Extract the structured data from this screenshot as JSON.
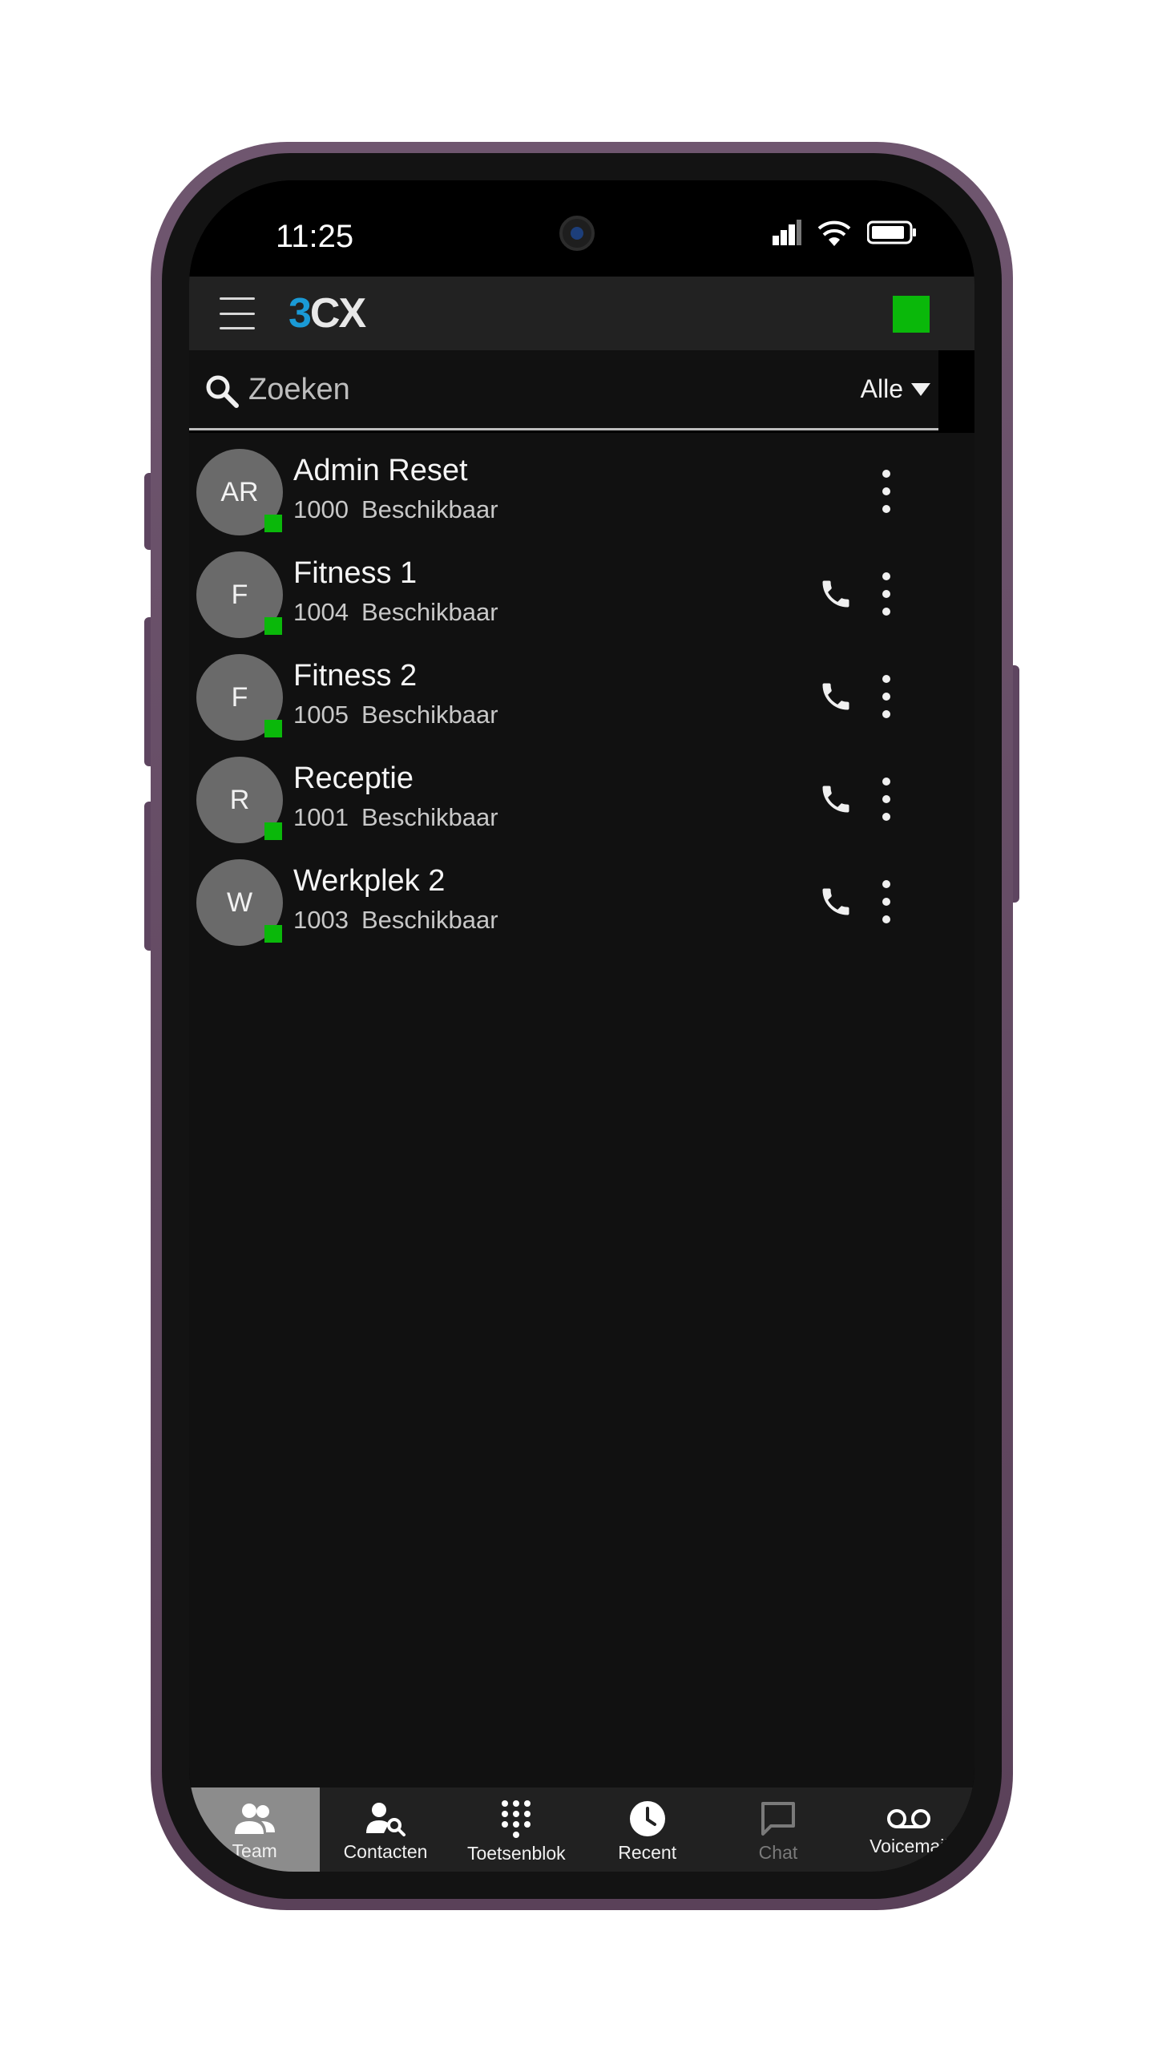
{
  "status_bar": {
    "time": "11:25"
  },
  "app": {
    "logo_main": "3",
    "logo_rest": "CX",
    "presence_color": "#0ab80a"
  },
  "search": {
    "placeholder": "Zoeken",
    "filter_label": "Alle"
  },
  "contacts": [
    {
      "initials": "AR",
      "name": "Admin Reset",
      "extension": "1000",
      "status": "Beschikbaar",
      "callable": false
    },
    {
      "initials": "F",
      "name": "Fitness 1",
      "extension": "1004",
      "status": "Beschikbaar",
      "callable": true
    },
    {
      "initials": "F",
      "name": "Fitness 2",
      "extension": "1005",
      "status": "Beschikbaar",
      "callable": true
    },
    {
      "initials": "R",
      "name": "Receptie",
      "extension": "1001",
      "status": "Beschikbaar",
      "callable": true
    },
    {
      "initials": "W",
      "name": "Werkplek 2",
      "extension": "1003",
      "status": "Beschikbaar",
      "callable": true
    }
  ],
  "bottom_nav": [
    {
      "label": "Team",
      "icon": "team-icon",
      "active": true
    },
    {
      "label": "Contacten",
      "icon": "contact-search-icon"
    },
    {
      "label": "Toetsenblok",
      "icon": "dialpad-icon"
    },
    {
      "label": "Recent",
      "icon": "clock-icon"
    },
    {
      "label": "Chat",
      "icon": "chat-icon",
      "disabled": true
    },
    {
      "label": "Voicemail",
      "icon": "voicemail-icon"
    }
  ]
}
